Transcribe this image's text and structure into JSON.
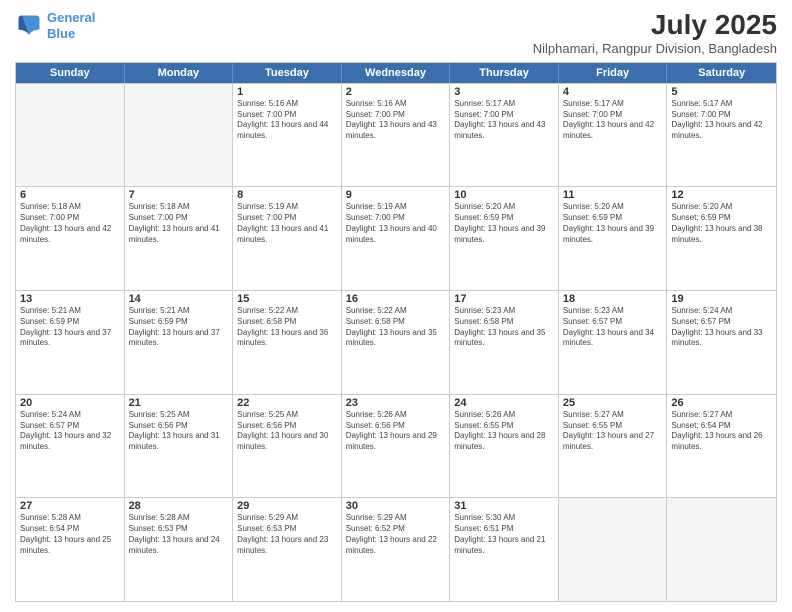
{
  "logo": {
    "line1": "General",
    "line2": "Blue"
  },
  "title": "July 2025",
  "subtitle": "Nilphamari, Rangpur Division, Bangladesh",
  "header_days": [
    "Sunday",
    "Monday",
    "Tuesday",
    "Wednesday",
    "Thursday",
    "Friday",
    "Saturday"
  ],
  "weeks": [
    [
      {
        "day": "",
        "info": ""
      },
      {
        "day": "",
        "info": ""
      },
      {
        "day": "1",
        "info": "Sunrise: 5:16 AM\nSunset: 7:00 PM\nDaylight: 13 hours and 44 minutes."
      },
      {
        "day": "2",
        "info": "Sunrise: 5:16 AM\nSunset: 7:00 PM\nDaylight: 13 hours and 43 minutes."
      },
      {
        "day": "3",
        "info": "Sunrise: 5:17 AM\nSunset: 7:00 PM\nDaylight: 13 hours and 43 minutes."
      },
      {
        "day": "4",
        "info": "Sunrise: 5:17 AM\nSunset: 7:00 PM\nDaylight: 13 hours and 42 minutes."
      },
      {
        "day": "5",
        "info": "Sunrise: 5:17 AM\nSunset: 7:00 PM\nDaylight: 13 hours and 42 minutes."
      }
    ],
    [
      {
        "day": "6",
        "info": "Sunrise: 5:18 AM\nSunset: 7:00 PM\nDaylight: 13 hours and 42 minutes."
      },
      {
        "day": "7",
        "info": "Sunrise: 5:18 AM\nSunset: 7:00 PM\nDaylight: 13 hours and 41 minutes."
      },
      {
        "day": "8",
        "info": "Sunrise: 5:19 AM\nSunset: 7:00 PM\nDaylight: 13 hours and 41 minutes."
      },
      {
        "day": "9",
        "info": "Sunrise: 5:19 AM\nSunset: 7:00 PM\nDaylight: 13 hours and 40 minutes."
      },
      {
        "day": "10",
        "info": "Sunrise: 5:20 AM\nSunset: 6:59 PM\nDaylight: 13 hours and 39 minutes."
      },
      {
        "day": "11",
        "info": "Sunrise: 5:20 AM\nSunset: 6:59 PM\nDaylight: 13 hours and 39 minutes."
      },
      {
        "day": "12",
        "info": "Sunrise: 5:20 AM\nSunset: 6:59 PM\nDaylight: 13 hours and 38 minutes."
      }
    ],
    [
      {
        "day": "13",
        "info": "Sunrise: 5:21 AM\nSunset: 6:59 PM\nDaylight: 13 hours and 37 minutes."
      },
      {
        "day": "14",
        "info": "Sunrise: 5:21 AM\nSunset: 6:59 PM\nDaylight: 13 hours and 37 minutes."
      },
      {
        "day": "15",
        "info": "Sunrise: 5:22 AM\nSunset: 6:58 PM\nDaylight: 13 hours and 36 minutes."
      },
      {
        "day": "16",
        "info": "Sunrise: 5:22 AM\nSunset: 6:58 PM\nDaylight: 13 hours and 35 minutes."
      },
      {
        "day": "17",
        "info": "Sunrise: 5:23 AM\nSunset: 6:58 PM\nDaylight: 13 hours and 35 minutes."
      },
      {
        "day": "18",
        "info": "Sunrise: 5:23 AM\nSunset: 6:57 PM\nDaylight: 13 hours and 34 minutes."
      },
      {
        "day": "19",
        "info": "Sunrise: 5:24 AM\nSunset: 6:57 PM\nDaylight: 13 hours and 33 minutes."
      }
    ],
    [
      {
        "day": "20",
        "info": "Sunrise: 5:24 AM\nSunset: 6:57 PM\nDaylight: 13 hours and 32 minutes."
      },
      {
        "day": "21",
        "info": "Sunrise: 5:25 AM\nSunset: 6:56 PM\nDaylight: 13 hours and 31 minutes."
      },
      {
        "day": "22",
        "info": "Sunrise: 5:25 AM\nSunset: 6:56 PM\nDaylight: 13 hours and 30 minutes."
      },
      {
        "day": "23",
        "info": "Sunrise: 5:26 AM\nSunset: 6:56 PM\nDaylight: 13 hours and 29 minutes."
      },
      {
        "day": "24",
        "info": "Sunrise: 5:26 AM\nSunset: 6:55 PM\nDaylight: 13 hours and 28 minutes."
      },
      {
        "day": "25",
        "info": "Sunrise: 5:27 AM\nSunset: 6:55 PM\nDaylight: 13 hours and 27 minutes."
      },
      {
        "day": "26",
        "info": "Sunrise: 5:27 AM\nSunset: 6:54 PM\nDaylight: 13 hours and 26 minutes."
      }
    ],
    [
      {
        "day": "27",
        "info": "Sunrise: 5:28 AM\nSunset: 6:54 PM\nDaylight: 13 hours and 25 minutes."
      },
      {
        "day": "28",
        "info": "Sunrise: 5:28 AM\nSunset: 6:53 PM\nDaylight: 13 hours and 24 minutes."
      },
      {
        "day": "29",
        "info": "Sunrise: 5:29 AM\nSunset: 6:53 PM\nDaylight: 13 hours and 23 minutes."
      },
      {
        "day": "30",
        "info": "Sunrise: 5:29 AM\nSunset: 6:52 PM\nDaylight: 13 hours and 22 minutes."
      },
      {
        "day": "31",
        "info": "Sunrise: 5:30 AM\nSunset: 6:51 PM\nDaylight: 13 hours and 21 minutes."
      },
      {
        "day": "",
        "info": ""
      },
      {
        "day": "",
        "info": ""
      }
    ]
  ]
}
